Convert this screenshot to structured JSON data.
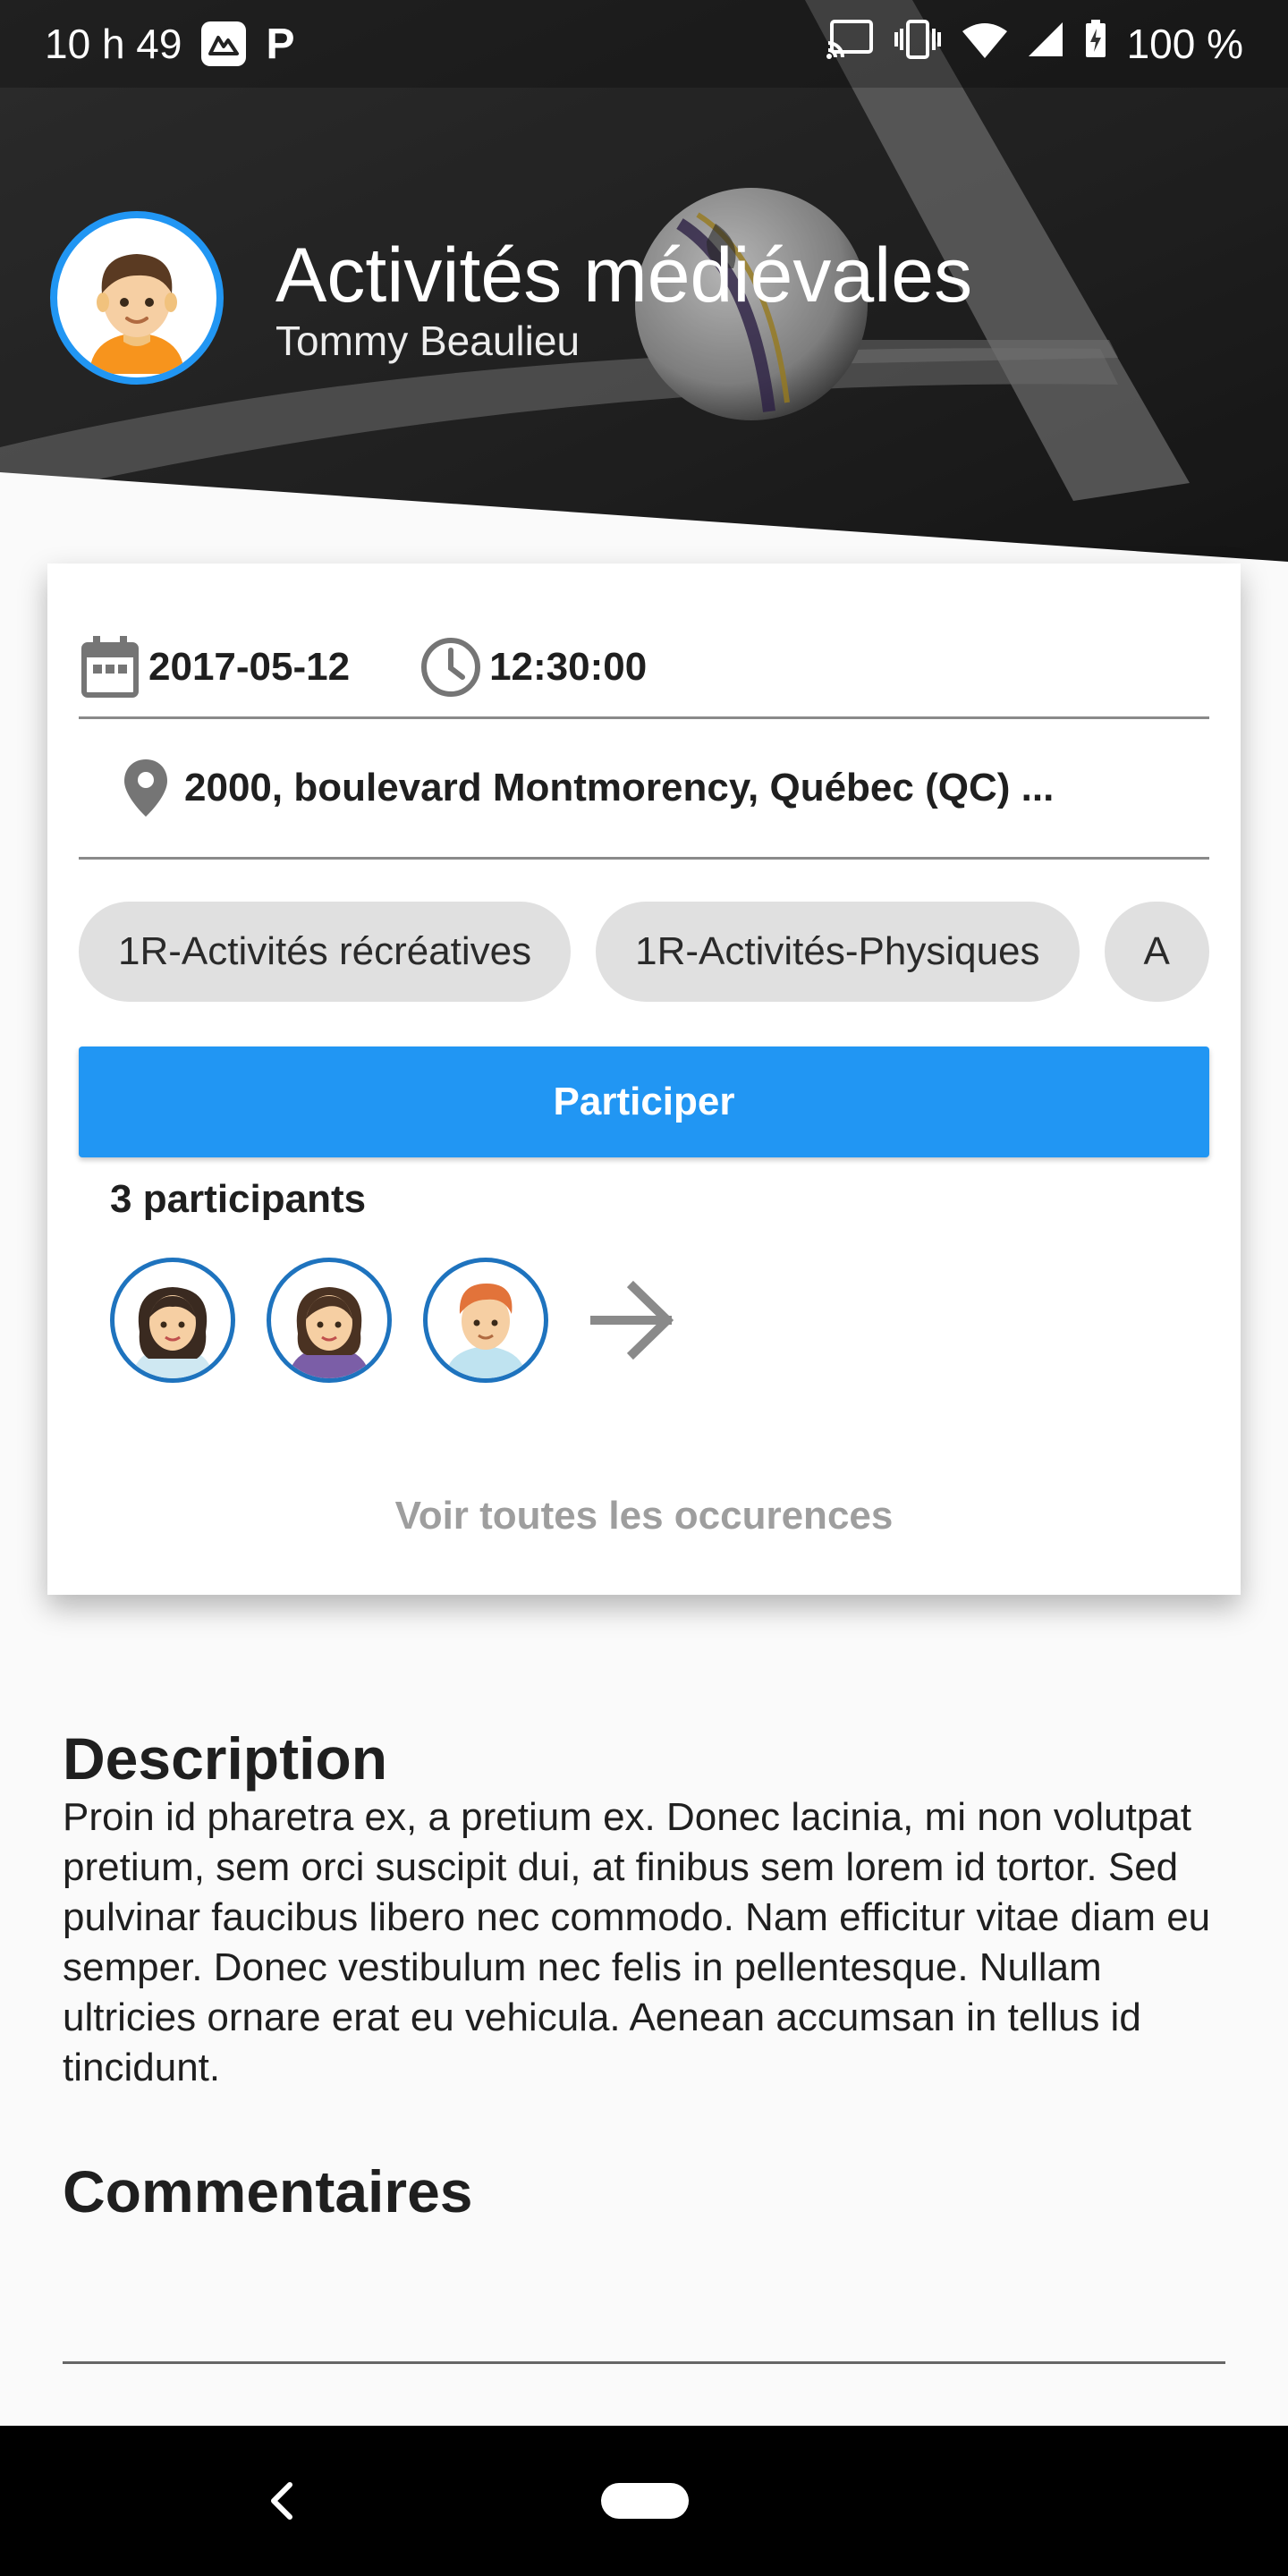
{
  "status_bar": {
    "time": "10 h 49",
    "app_badge": "P",
    "battery": "100 %"
  },
  "header": {
    "title": "Activités médiévales",
    "organizer": "Tommy Beaulieu"
  },
  "details": {
    "date": "2017-05-12",
    "time": "12:30:00",
    "address": "2000, boulevard Montmorency, Québec (QC) ..."
  },
  "tags": [
    "1R-Activités récréatives",
    "1R-Activités-Physiques",
    "A"
  ],
  "participate_label": "Participer",
  "participants": {
    "count_label": "3 participants"
  },
  "see_all_label": "Voir toutes les occurences",
  "description": {
    "title": "Description",
    "text": "Proin id pharetra ex, a pretium ex. Donec lacinia, mi non volutpat pretium, sem orci suscipit dui, at finibus sem lorem id tortor. Sed pulvinar faucibus libero nec commodo. Nam efficitur vitae diam eu semper. Donec vestibulum nec felis in pellentesque. Nullam ultricies ornare erat eu vehicula. Aenean accumsan in tellus id tincidunt."
  },
  "comments": {
    "title": "Commentaires"
  },
  "colors": {
    "accent": "#2196f3",
    "chip_bg": "#e0e0e0",
    "page_bg": "#fafafa"
  },
  "icons": [
    "calendar-icon",
    "clock-icon",
    "location-pin-icon",
    "arrow-right-icon",
    "cast-icon",
    "vibrate-icon",
    "wifi-icon",
    "signal-icon",
    "battery-icon",
    "back-icon"
  ]
}
